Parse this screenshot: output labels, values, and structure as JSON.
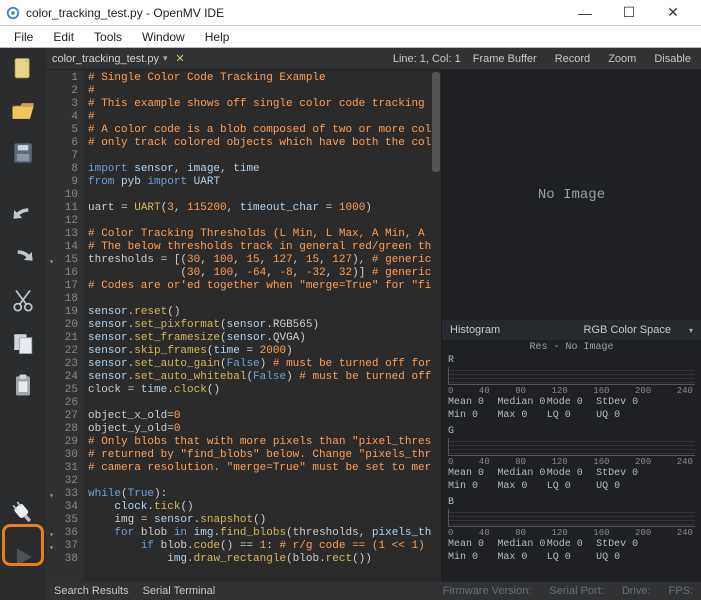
{
  "window": {
    "title": "color_tracking_test.py - OpenMV IDE"
  },
  "menus": [
    "File",
    "Edit",
    "Tools",
    "Window",
    "Help"
  ],
  "tab": {
    "filename": "color_tracking_test.py",
    "cursor": "Line: 1, Col: 1"
  },
  "right_header": {
    "frame_buffer": "Frame Buffer",
    "record": "Record",
    "zoom": "Zoom",
    "disable": "Disable"
  },
  "framebuf_placeholder": "No Image",
  "histogram": {
    "title": "Histogram",
    "mode": "RGB Color Space",
    "res": "Res - No Image",
    "axis_ticks": [
      "0",
      "40",
      "80",
      "120",
      "160",
      "200",
      "240"
    ],
    "channels": [
      "R",
      "G",
      "B"
    ],
    "stat_labels": [
      "Mean",
      "Median",
      "Mode",
      "StDev",
      "Min",
      "Max",
      "LQ",
      "UQ"
    ],
    "stat_value": "0"
  },
  "status": {
    "left": [
      "Search Results",
      "Serial Terminal"
    ],
    "right": [
      "Firmware Version:",
      "Serial Port:",
      "Drive:",
      "FPS:"
    ]
  },
  "code_lines": [
    {
      "n": 1,
      "h": "<span class='c-comment'># Single Color Code Tracking Example</span>"
    },
    {
      "n": 2,
      "h": "<span class='c-comment'>#</span>"
    },
    {
      "n": 3,
      "h": "<span class='c-comment'># This example shows off single color code tracking</span>"
    },
    {
      "n": 4,
      "h": "<span class='c-comment'>#</span>"
    },
    {
      "n": 5,
      "h": "<span class='c-comment'># A color code is a blob composed of two or more col</span>"
    },
    {
      "n": 6,
      "h": "<span class='c-comment'># only track colored objects which have both the col</span>"
    },
    {
      "n": 7,
      "h": ""
    },
    {
      "n": 8,
      "h": "<span class='c-kw'>import</span> <span class='c-id'>sensor</span>, <span class='c-id'>image</span>, <span class='c-id'>time</span>"
    },
    {
      "n": 9,
      "h": "<span class='c-kw'>from</span> <span class='c-id'>pyb</span> <span class='c-kw'>import</span> <span class='c-id'>UART</span>"
    },
    {
      "n": 10,
      "h": ""
    },
    {
      "n": 11,
      "h": "<span class='c-def'>uart</span> = <span class='c-fn'>UART</span>(<span class='c-num'>3</span>, <span class='c-num'>115200</span>, <span class='c-id'>timeout_char</span> = <span class='c-num'>1000</span>)"
    },
    {
      "n": 12,
      "h": ""
    },
    {
      "n": 13,
      "h": "<span class='c-comment'># Color Tracking Thresholds (L Min, L Max, A Min, A </span>"
    },
    {
      "n": 14,
      "h": "<span class='c-comment'># The below thresholds track in general red/green th</span>"
    },
    {
      "n": 15,
      "fold": true,
      "h": "<span class='c-def'>thresholds</span> = [(<span class='c-num'>30</span>, <span class='c-num'>100</span>, <span class='c-num'>15</span>, <span class='c-num'>127</span>, <span class='c-num'>15</span>, <span class='c-num'>127</span>), <span class='c-comment'># generic</span>"
    },
    {
      "n": 16,
      "h": "              (<span class='c-num'>30</span>, <span class='c-num'>100</span>, <span class='c-num'>-64</span>, <span class='c-num'>-8</span>, <span class='c-num'>-32</span>, <span class='c-num'>32</span>)] <span class='c-comment'># generic</span>"
    },
    {
      "n": 17,
      "h": "<span class='c-comment'># Codes are or'ed together when \"merge=True\" for \"fi</span>"
    },
    {
      "n": 18,
      "h": ""
    },
    {
      "n": 19,
      "h": "<span class='c-id'>sensor</span>.<span class='c-fn'>reset</span>()"
    },
    {
      "n": 20,
      "h": "<span class='c-id'>sensor</span>.<span class='c-fn'>set_pixformat</span>(<span class='c-id'>sensor</span>.RGB565)"
    },
    {
      "n": 21,
      "h": "<span class='c-id'>sensor</span>.<span class='c-fn'>set_framesize</span>(<span class='c-id'>sensor</span>.QVGA)"
    },
    {
      "n": 22,
      "h": "<span class='c-id'>sensor</span>.<span class='c-fn'>skip_frames</span>(<span class='c-id'>time</span> = <span class='c-num'>2000</span>)"
    },
    {
      "n": 23,
      "h": "<span class='c-id'>sensor</span>.<span class='c-fn'>set_auto_gain</span>(<span class='c-kw'>False</span>) <span class='c-comment'># must be turned off for</span>"
    },
    {
      "n": 24,
      "h": "<span class='c-id'>sensor</span>.<span class='c-fn'>set_auto_whitebal</span>(<span class='c-kw'>False</span>) <span class='c-comment'># must be turned off</span>"
    },
    {
      "n": 25,
      "h": "<span class='c-def'>clock</span> = <span class='c-id'>time</span>.<span class='c-fn'>clock</span>()"
    },
    {
      "n": 26,
      "h": ""
    },
    {
      "n": 27,
      "h": "<span class='c-def'>object_x_old</span>=<span class='c-num'>0</span>"
    },
    {
      "n": 28,
      "h": "<span class='c-def'>object_y_old</span>=<span class='c-num'>0</span>"
    },
    {
      "n": 29,
      "h": "<span class='c-comment'># Only blobs that with more pixels than \"pixel_thres</span>"
    },
    {
      "n": 30,
      "h": "<span class='c-comment'># returned by \"find_blobs\" below. Change \"pixels_thr</span>"
    },
    {
      "n": 31,
      "h": "<span class='c-comment'># camera resolution. \"merge=True\" must be set to mer</span>"
    },
    {
      "n": 32,
      "h": ""
    },
    {
      "n": 33,
      "fold": true,
      "h": "<span class='c-kw'>while</span>(<span class='c-kw'>True</span>):"
    },
    {
      "n": 34,
      "h": "    <span class='c-id'>clock</span>.<span class='c-fn'>tick</span>()"
    },
    {
      "n": 35,
      "h": "    <span class='c-def'>img</span> = <span class='c-id'>sensor</span>.<span class='c-fn'>snapshot</span>()"
    },
    {
      "n": 36,
      "fold": true,
      "h": "    <span class='c-kw'>for</span> blob <span class='c-kw'>in</span> <span class='c-id'>img</span>.<span class='c-fn'>find_blobs</span>(thresholds, <span class='c-id'>pixels_th</span>"
    },
    {
      "n": 37,
      "fold": true,
      "h": "        <span class='c-kw'>if</span> blob.<span class='c-fn'>code</span>() == <span class='c-num'>1</span>: <span class='c-comment'># r/g code == (1 &lt;&lt; 1)</span>"
    },
    {
      "n": 38,
      "h": "            <span class='c-id'>img</span>.<span class='c-fn'>draw_rectangle</span>(blob.<span class='c-fn'>rect</span>())"
    }
  ]
}
